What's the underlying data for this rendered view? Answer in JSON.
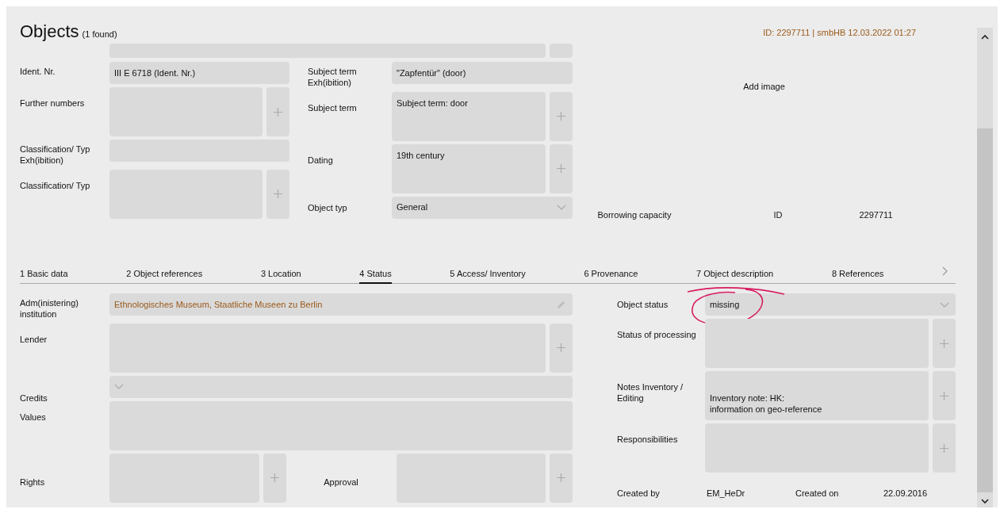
{
  "header": {
    "title": "Objects",
    "count": "(1 found)",
    "record_info": "ID: 2297711 | smbHB 12.03.2022 01:27"
  },
  "top_left": [
    {
      "label": "Ident. Nr.",
      "kind": "text",
      "value": "III E 6718 (Ident. Nr.)"
    },
    {
      "label": "Further numbers",
      "kind": "multi"
    },
    {
      "label": "Classification/ Typ Exh(ibition)",
      "kind": "text"
    },
    {
      "label": "Classification/ Typ",
      "kind": "multi"
    }
  ],
  "top_middle": [
    {
      "label": "Subject term Exh(ibition)",
      "kind": "text",
      "value": "\"Zapfentür\" (door)"
    },
    {
      "label": "Subject term",
      "kind": "multi",
      "value": "Subject term: door"
    },
    {
      "label": "Dating",
      "kind": "multi",
      "value": "19th century"
    },
    {
      "label": "Object typ",
      "kind": "select",
      "value": "General"
    }
  ],
  "image": {
    "label": "Add image"
  },
  "borrowing": {
    "label": "Borrowing capacity",
    "id_label": "ID",
    "id_value": "2297711"
  },
  "tabs": [
    {
      "label": "1 Basic data",
      "selected": false
    },
    {
      "label": "2 Object references",
      "selected": false
    },
    {
      "label": "3 Location",
      "selected": false
    },
    {
      "label": "4 Status",
      "selected": true
    },
    {
      "label": "5 Access/ Inventory",
      "selected": false
    },
    {
      "label": "6 Provenance",
      "selected": false
    },
    {
      "label": "7 Object description",
      "selected": false
    },
    {
      "label": "8 References",
      "selected": false
    }
  ],
  "lower_left": [
    {
      "label": "Adm(inistering) institution",
      "kind": "edit",
      "value": "Ethnologisches Museum, Staatliche Museen zu Berlin"
    },
    {
      "label": "Lender",
      "kind": "multi"
    },
    {
      "label": "Credits",
      "kind": "select"
    },
    {
      "label": "Values",
      "kind": "area"
    },
    {
      "label": "Rights",
      "kind": "pair",
      "second_label": "Approval"
    }
  ],
  "lower_right": [
    {
      "label": "Object status",
      "kind": "select",
      "value": "missing",
      "annotated": true
    },
    {
      "label": "Status of processing",
      "kind": "multi"
    },
    {
      "label": "Notes Inventory / Editing",
      "kind": "multi",
      "value": "Inventory note: HK:\ninformation on geo-reference"
    },
    {
      "label": "Responsibilities",
      "kind": "multi"
    }
  ],
  "created": {
    "by_label": "Created by",
    "by": "EM_HeDr",
    "on_label": "Created on",
    "on": "22.09.2016"
  }
}
